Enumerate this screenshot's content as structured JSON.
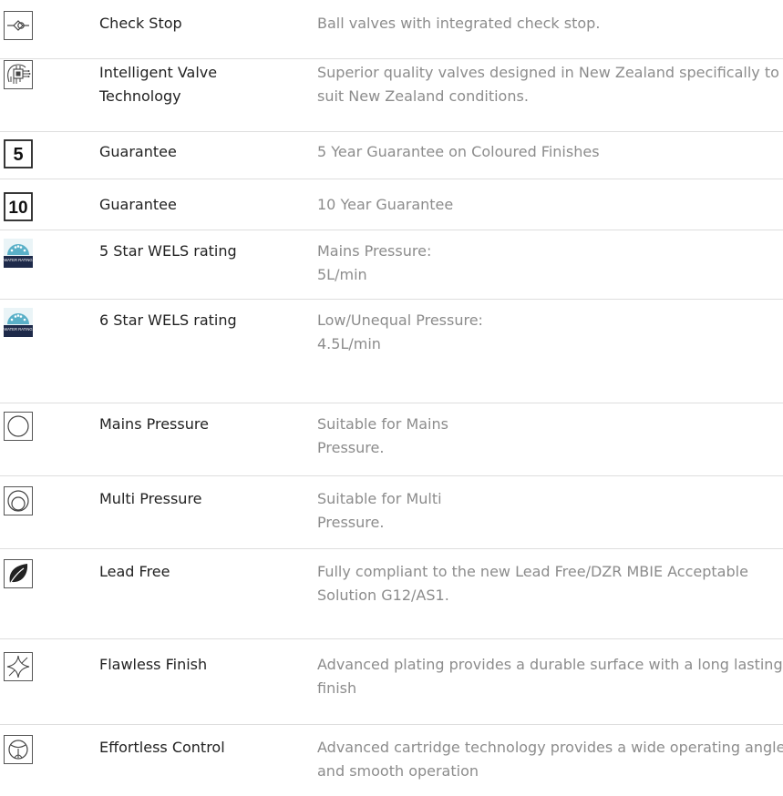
{
  "features": [
    {
      "icon": "check-stop-icon",
      "name": "Check Stop",
      "description": "Ball valves with integrated check stop."
    },
    {
      "icon": "intelligent-valve-icon",
      "name": "Intelligent Valve Technology",
      "description": "Superior quality valves designed in New Zealand specifically to suit New Zealand conditions."
    },
    {
      "icon": "guarantee-5-icon",
      "icon_text": "5",
      "name": "Guarantee",
      "description": "5 Year Guarantee on Coloured Finishes"
    },
    {
      "icon": "guarantee-10-icon",
      "icon_text": "10",
      "name": "Guarantee",
      "description": "10 Year Guarantee"
    },
    {
      "icon": "wels-rating-icon",
      "icon_text": "WATER RATING",
      "name": "5 Star WELS rating",
      "description_lines": [
        "Mains Pressure:",
        "5L/min"
      ]
    },
    {
      "icon": "wels-rating-icon",
      "icon_text": "WATER RATING",
      "name": "6 Star WELS rating",
      "description_lines": [
        "Low/Unequal Pressure:",
        "4.5L/min"
      ]
    },
    {
      "icon": "mains-pressure-icon",
      "name": "Mains Pressure",
      "description_lines": [
        "Suitable for Mains",
        "Pressure."
      ]
    },
    {
      "icon": "multi-pressure-icon",
      "name": "Multi Pressure",
      "description_lines": [
        "Suitable for Multi",
        "Pressure."
      ]
    },
    {
      "icon": "leaf-icon",
      "name": "Lead Free",
      "description": "Fully compliant to the new Lead Free/DZR MBIE Acceptable Solution G12/AS1."
    },
    {
      "icon": "flawless-finish-icon",
      "name": "Flawless Finish",
      "description": "Advanced plating provides a durable surface with a long lasting finish"
    },
    {
      "icon": "effortless-control-icon",
      "name": "Effortless Control",
      "description": "Advanced cartridge technology provides a wide operating angle and smooth operation"
    }
  ],
  "colors": {
    "name_text": "#222222",
    "description_text": "#8c8c8c",
    "divider": "#dedede",
    "icon_stroke": "#444444",
    "wels_badge_top": "#5ab0c8",
    "wels_badge_bottom": "#1e2a4a"
  }
}
